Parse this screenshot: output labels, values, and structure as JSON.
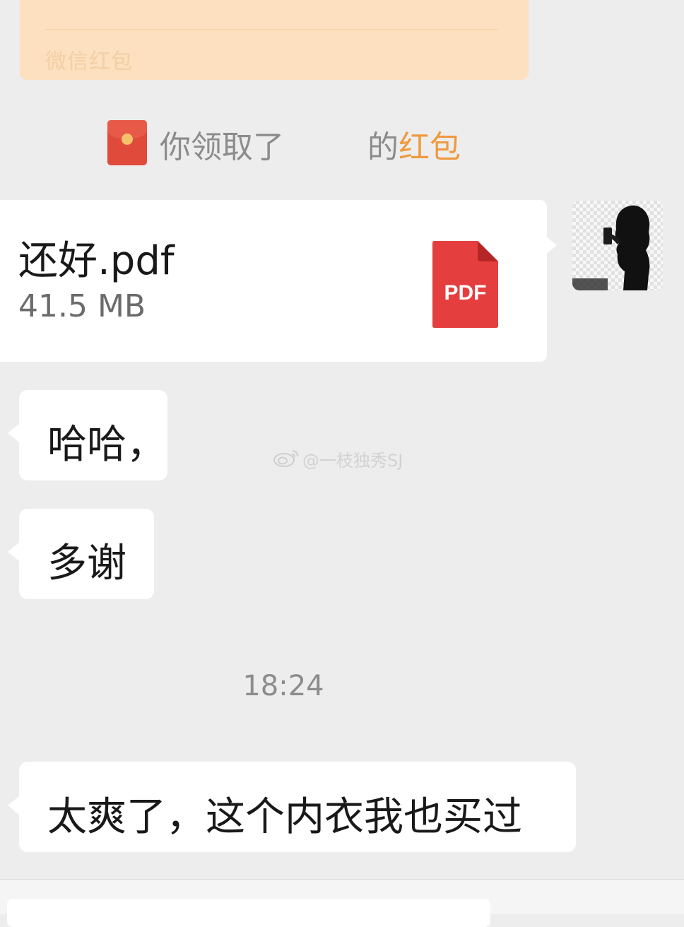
{
  "colors": {
    "chat_background": "#ededed",
    "bubble_background": "#ffffff",
    "redpacket_card": "#fce0bf",
    "redpacket_link": "#ef9a3f",
    "pdf_red": "#e53e3e",
    "meta_text": "#8c8c8c"
  },
  "redpacket_card": {
    "footer_label": "微信红包"
  },
  "system_notice": {
    "icon": "red-packet-icon",
    "prefix": "你领取了",
    "suffix": "的",
    "link": "红包"
  },
  "file_message": {
    "file_name": "还好.pdf",
    "file_size": "41.5 MB",
    "file_type_label": "PDF",
    "icon": "pdf-file-icon"
  },
  "sender_avatar": {
    "icon": "avatar-silhouette"
  },
  "messages": [
    {
      "text": "哈哈，"
    },
    {
      "text": "多谢"
    }
  ],
  "timestamp": "18:24",
  "last_message": {
    "text": "太爽了，这个内衣我也买过"
  },
  "watermark": {
    "icon": "weibo-icon",
    "text": "@一枝独秀SJ"
  }
}
